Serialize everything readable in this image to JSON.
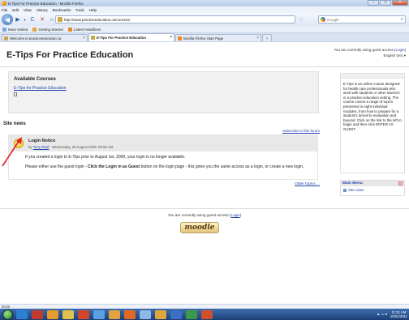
{
  "window": {
    "title": "E-Tips For Practice Education - Mozilla Firefox",
    "buttons": {
      "minimize": "–",
      "maximize": "□",
      "close": "✕"
    }
  },
  "menubar": [
    "File",
    "Edit",
    "View",
    "History",
    "Bookmarks",
    "Tools",
    "Help"
  ],
  "navbar": {
    "url": "http://www.practiceeducation.ca/courses/",
    "search_placeholder": "Google",
    "back_glyph": "◀",
    "forward_glyph": "▶",
    "dropdown_glyph": "▼",
    "reload_glyph": "C",
    "stop_glyph": "✕",
    "home_glyph": "⌂",
    "star_glyph": "☆",
    "search_glyph": "⌕"
  },
  "bookmarks": [
    {
      "label": "Most Visited",
      "color": "#7aa6d8"
    },
    {
      "label": "Getting Started",
      "color": "#e8a23c"
    },
    {
      "label": "Latest Headlines",
      "color": "#e08a2a"
    }
  ],
  "tabs": [
    {
      "label": "Welcome to practiceeducation.ca",
      "active": false
    },
    {
      "label": "E-Tips For Practice Education",
      "active": true
    },
    {
      "label": "Mozilla Firefox Start Page",
      "active": false
    }
  ],
  "tab_close_glyph": "×",
  "new_tab_glyph": "+",
  "page": {
    "site_title": "E-Tips For Practice Education",
    "login_info_prefix": "You are currently using guest access (",
    "login_link": "Login",
    "login_info_suffix": ")",
    "language": "English (en) ▾",
    "available_courses_heading": "Available Courses",
    "course_link": "E-Tips for Practice Education",
    "site_news_heading": "Site news",
    "subscribe_link": "Subscribe to this forum",
    "post": {
      "title": "Login Notice",
      "by": "by ",
      "author": "Terry Reid",
      "date": " - Wednesday, 26 August 2009, 09:58 AM",
      "para1": "If you created a login to E-Tips prior to August 1st, 2009, your login is no longer available.",
      "para2_a": "Please either use the guest login - ",
      "para2_bold": "Click the Login in as Guest",
      "para2_b": " button on the login page - this gives you the same access as a login, or create a new login."
    },
    "older_topics": "Older topics ...",
    "side_description": "E-Tips is an online course designed for health care professionals who work with students or other learners in a practice education setting. The course covers a range of topics presented in eight individual modules, from how to prepare for a student's arrival to evaluation and beyond. Click on the link to the left to begin and then click ENTER AS GUEST",
    "main_menu_heading": "Main Menu",
    "main_menu_item": "Site news",
    "footer_prefix": "You are currently using guest access (",
    "footer_link": "Login",
    "footer_suffix": ")",
    "moodle_logo": "moodle"
  },
  "statusbar": "Done",
  "tray": {
    "time": "11:31 AM",
    "date": "10/01/2011"
  },
  "annotation_color": "#e0201c"
}
